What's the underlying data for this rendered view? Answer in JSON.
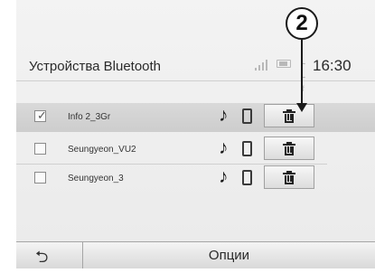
{
  "callout": {
    "number": "2"
  },
  "header": {
    "title": "Устройства Bluetooth",
    "time": "16:30",
    "status_icons": [
      "signal-icon",
      "battery-icon",
      "network-icon"
    ]
  },
  "devices": [
    {
      "name": "Info 2_3Gr",
      "checked": true,
      "selected": true
    },
    {
      "name": "Seungyeon_VU2",
      "checked": false,
      "selected": false
    },
    {
      "name": "Seungyeon_3",
      "checked": false,
      "selected": false
    }
  ],
  "row_icons": {
    "music": "music-note-icon",
    "phone": "phone-icon",
    "delete": "trash-icon"
  },
  "footer": {
    "back_icon": "back-arrow-icon",
    "options_label": "Опции"
  },
  "colors": {
    "selected_row": "#d3d3d3",
    "background": "#efefef"
  }
}
